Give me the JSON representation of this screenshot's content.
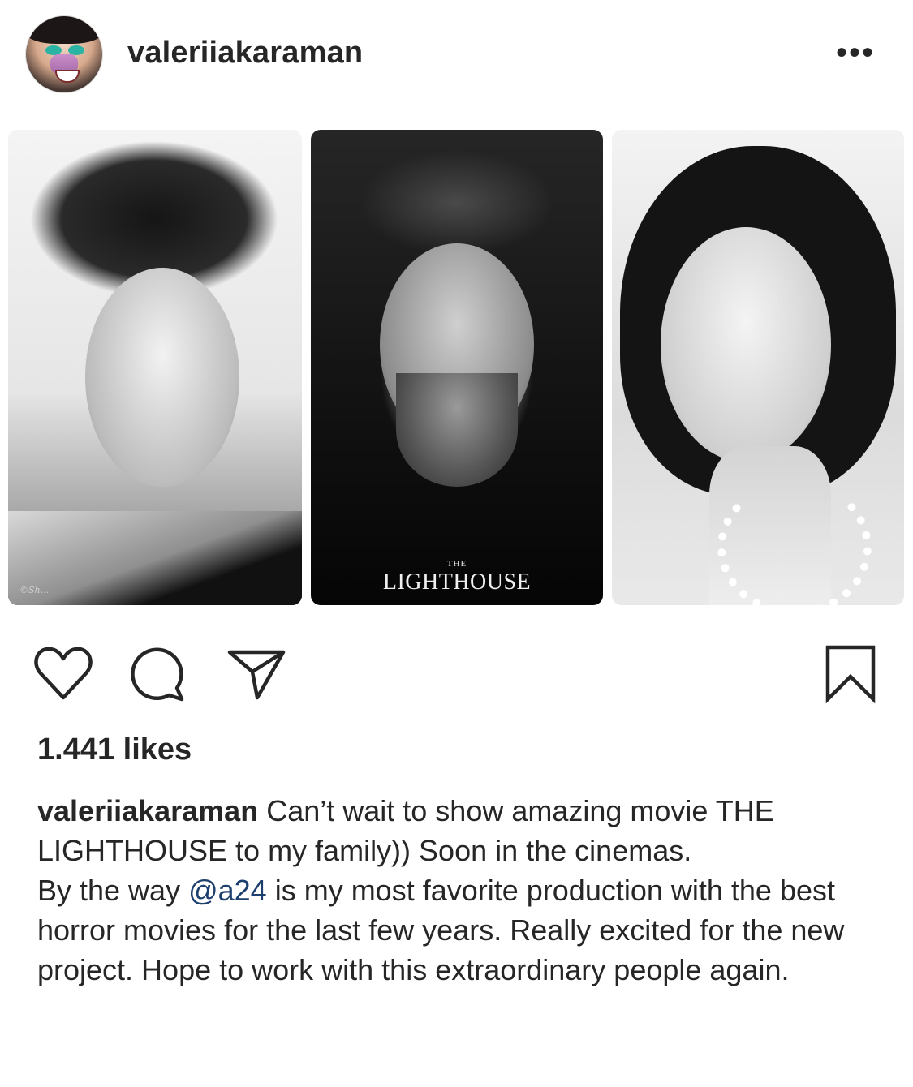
{
  "post": {
    "username": "valeriiakaraman",
    "more_label": "•••",
    "images": {
      "watermark": "©Sh...",
      "poster_small": "THE",
      "poster_title": "LIGHTHOUSE"
    },
    "likes": "1.441 likes",
    "caption": {
      "username": "valeriiakaraman",
      "line1": " Can’t wait to show amazing movie THE LIGHTHOUSE to my family)) Soon in the cinemas.",
      "line2_start": "By the way ",
      "mention": "@a24",
      "line2_end": " is my most favorite production with the best horror movies for the last few years. Really excited for the new project. Hope to work with this extraordinary people again."
    }
  },
  "icons": [
    "heart-icon",
    "comment-icon",
    "share-icon",
    "bookmark-icon",
    "more-icon"
  ],
  "colors": {
    "text": "#262626",
    "mention": "#1d3f6e",
    "divider": "#e6e6e6"
  }
}
